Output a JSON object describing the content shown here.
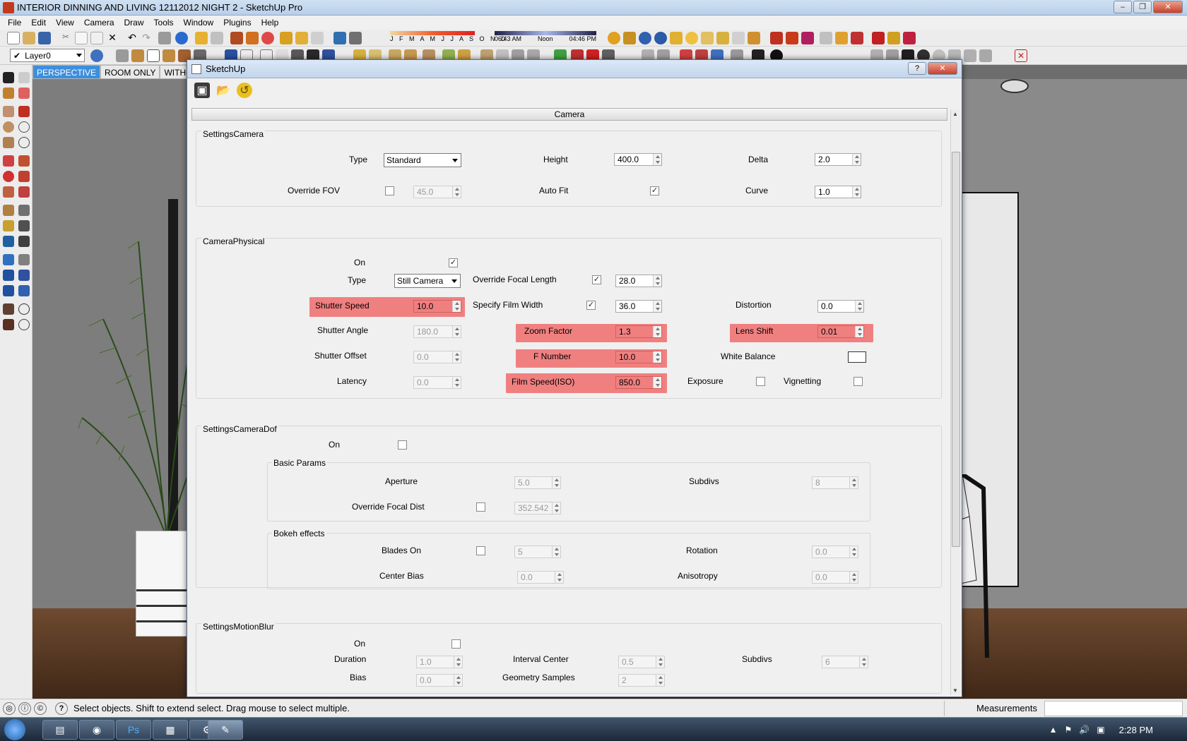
{
  "window": {
    "title": "INTERIOR DINNING AND LIVING 12112012 NIGHT 2 - SketchUp Pro",
    "controls": [
      "minimize-icon",
      "restore-icon",
      "close-icon"
    ]
  },
  "menu": [
    "File",
    "Edit",
    "View",
    "Camera",
    "Draw",
    "Tools",
    "Window",
    "Plugins",
    "Help"
  ],
  "toolbar": {
    "layer": "Layer0",
    "months": "J F M A M J J A S O N D",
    "time_start": "06:43 AM",
    "time_mid": "Noon",
    "time_end": "04:46 PM"
  },
  "scene_tabs": [
    "PERSPECTIVE",
    "ROOM ONLY",
    "WITHOU"
  ],
  "dialog": {
    "title": "SketchUp",
    "rollout": "Camera",
    "settings_camera": {
      "title": "SettingsCamera",
      "type_label": "Type",
      "type_value": "Standard",
      "height_label": "Height",
      "height_value": "400.0",
      "delta_label": "Delta",
      "delta_value": "2.0",
      "override_fov_label": "Override FOV",
      "override_fov_value": "45.0",
      "auto_fit_label": "Auto Fit",
      "curve_label": "Curve",
      "curve_value": "1.0"
    },
    "camera_physical": {
      "title": "CameraPhysical",
      "on_label": "On",
      "type_label": "Type",
      "type_value": "Still Camera",
      "override_focal_label": "Override Focal Length",
      "override_focal_value": "28.0",
      "shutter_speed_label": "Shutter Speed",
      "shutter_speed_value": "10.0",
      "film_width_label": "Specify Film Width",
      "film_width_value": "36.0",
      "distortion_label": "Distortion",
      "distortion_value": "0.0",
      "shutter_angle_label": "Shutter Angle",
      "shutter_angle_value": "180.0",
      "zoom_label": "Zoom Factor",
      "zoom_value": "1.3",
      "lens_shift_label": "Lens Shift",
      "lens_shift_value": "0.01",
      "shutter_offset_label": "Shutter Offset",
      "shutter_offset_value": "0.0",
      "fnumber_label": "F Number",
      "fnumber_value": "10.0",
      "white_balance_label": "White Balance",
      "latency_label": "Latency",
      "latency_value": "0.0",
      "iso_label": "Film Speed(ISO)",
      "iso_value": "850.0",
      "exposure_label": "Exposure",
      "vignetting_label": "Vignetting"
    },
    "dof": {
      "title": "SettingsCameraDof",
      "on_label": "On",
      "basic_params": "Basic Params",
      "aperture_label": "Aperture",
      "aperture_value": "5.0",
      "subdivs_label": "Subdivs",
      "subdivs_value": "8",
      "override_focal_dist_label": "Override Focal Dist",
      "override_focal_dist_value": "352.542",
      "bokeh": "Bokeh effects",
      "blades_label": "Blades On",
      "blades_value": "5",
      "rotation_label": "Rotation",
      "rotation_value": "0.0",
      "center_bias_label": "Center Bias",
      "center_bias_value": "0.0",
      "anisotropy_label": "Anisotropy",
      "anisotropy_value": "0.0"
    },
    "motion_blur": {
      "title": "SettingsMotionBlur",
      "on_label": "On",
      "duration_label": "Duration",
      "duration_value": "1.0",
      "interval_label": "Interval Center",
      "interval_value": "0.5",
      "subdivs_label": "Subdivs",
      "subdivs_value": "6",
      "bias_label": "Bias",
      "bias_value": "0.0",
      "geom_label": "Geometry Samples",
      "geom_value": "2"
    }
  },
  "status": {
    "message": "Select objects. Shift to extend select. Drag mouse to select multiple.",
    "measurements": "Measurements"
  },
  "taskbar": {
    "clock": "2:28 PM"
  },
  "colors": {
    "highlight": "#f08080",
    "scene_tab_active": "#3d8fdd"
  }
}
